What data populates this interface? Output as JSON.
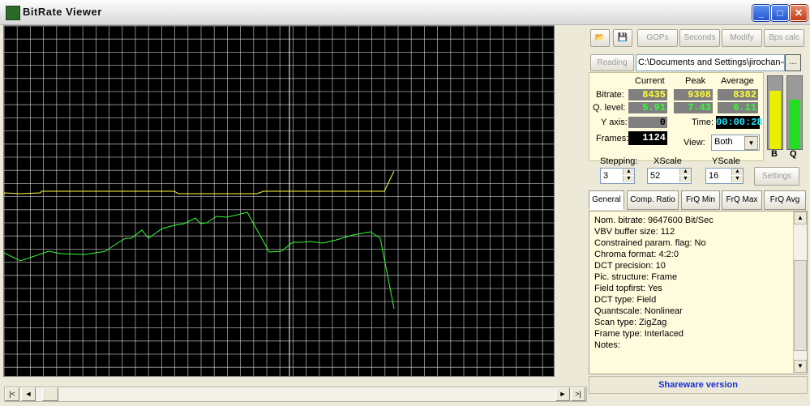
{
  "window": {
    "title": "BitRate  Viewer",
    "minimize": "_",
    "maximize": "□",
    "close": "✕"
  },
  "toolbar": {
    "gops": "GOPs",
    "seconds": "Seconds",
    "modify": "Modify",
    "bps_calc": "Bps calc"
  },
  "reading": {
    "label": "Reading",
    "path": "C:\\Documents and Settings\\jirochan-g"
  },
  "stats": {
    "headers": [
      "Current",
      "Peak",
      "Average"
    ],
    "bitrate": {
      "label": "Bitrate:",
      "current": "8435",
      "peak": "9308",
      "average": "8382"
    },
    "qlevel": {
      "label": "Q. level:",
      "current": "5.91",
      "peak": "7.43",
      "average": "6.11"
    },
    "yaxis": {
      "label": "Y axis:",
      "value": "0"
    },
    "time": {
      "label": "Time:",
      "value": "00:00:28"
    },
    "frames": {
      "label": "Frames:",
      "value": "1124"
    },
    "view": {
      "label": "View:",
      "value": "Both"
    }
  },
  "meters": {
    "b_label": "B",
    "q_label": "Q",
    "b_level": 0.82,
    "q_level": 0.69,
    "b_color": "#e8f000",
    "q_color": "#22dd22"
  },
  "controls": {
    "stepping": {
      "label": "Stepping:",
      "value": "3"
    },
    "xscale": {
      "label": "XScale",
      "value": "52"
    },
    "yscale": {
      "label": "YScale",
      "value": "16"
    },
    "settings": "Settings"
  },
  "tabs": [
    "General",
    "Comp. Ratio",
    "FrQ Min",
    "FrQ Max",
    "FrQ Avg"
  ],
  "info": [
    "Nom. bitrate: 9647600 Bit/Sec",
    "VBV buffer size: 112",
    "Constrained param. flag: No",
    "Chroma format: 4:2:0",
    "DCT precision: 10",
    "Pic. structure: Frame",
    "Field topfirst: Yes",
    "DCT type: Field",
    "Quantscale: Nonlinear",
    "Scan type: ZigZag",
    "Frame type: Interlaced",
    "Notes:"
  ],
  "footer": {
    "shareware": "Shareware version"
  },
  "scrollbar": {
    "first": "|<",
    "prev": "◄",
    "next": "►",
    "last": ">|"
  },
  "colors": {
    "bitrate_line": "#ffff44",
    "qlevel_line": "#33ff33",
    "grid": "#d8d8d8",
    "cursor": "#ffffff"
  }
}
